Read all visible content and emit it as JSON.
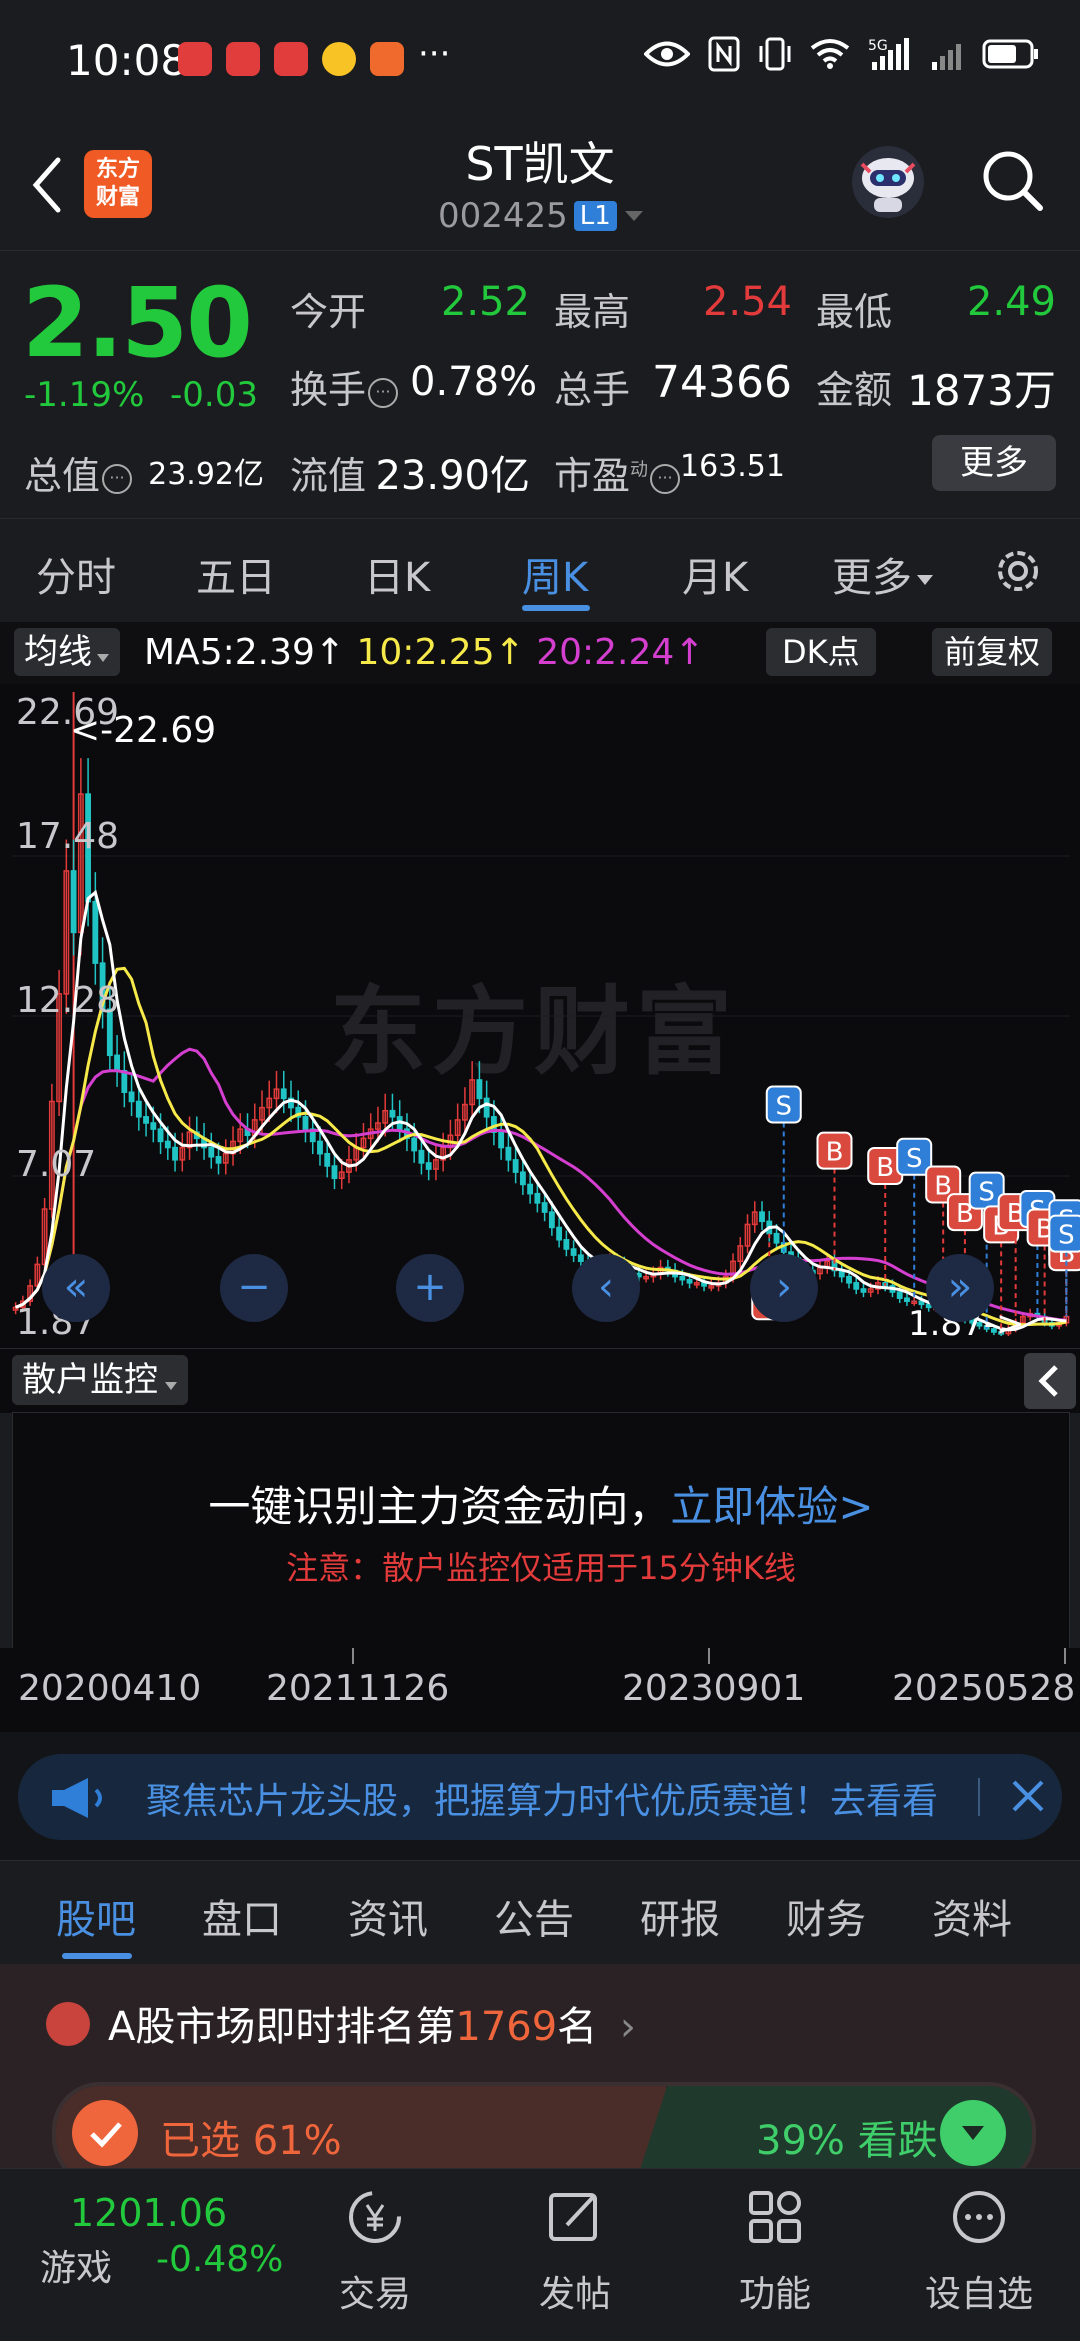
{
  "status": {
    "time": "10:08",
    "network": "5G",
    "more": "···"
  },
  "header": {
    "logo_line1": "东方",
    "logo_line2": "财富",
    "stock_name": "ST凯文",
    "stock_code": "002425",
    "level": "L1"
  },
  "quote": {
    "price": "2.50",
    "change_pct": "-1.19%",
    "change": "-0.03",
    "open_label": "今开",
    "open": "2.52",
    "high_label": "最高",
    "high": "2.54",
    "low_label": "最低",
    "low": "2.49",
    "turnover_label": "换手",
    "turnover": "0.78%",
    "volume_label": "总手",
    "volume": "74366",
    "amount_label": "金额",
    "amount": "1873万",
    "mktcap_label": "总值",
    "mktcap": "23.92亿",
    "float_label": "流值",
    "float": "23.90亿",
    "pe_label": "市盈",
    "pe_sup": "动",
    "pe": "163.51",
    "more_label": "更多"
  },
  "tabs": [
    "分时",
    "五日",
    "日K",
    "周K",
    "月K",
    "更多"
  ],
  "active_tab": "周K",
  "ma_row": {
    "selector": "均线",
    "ma5": "MA5:2.39↑",
    "ma10": "10:2.25↑",
    "ma20": "20:2.24↑",
    "dk": "DK点",
    "fq": "前复权"
  },
  "colors": {
    "up": "#e33b3b",
    "down": "#22c93c",
    "accent": "#4a90e2",
    "ma5": "#ffffff",
    "ma10": "#f6e94a",
    "ma20": "#d53fd0",
    "boll": "#20c4c4"
  },
  "chart": {
    "y_labels": [
      "22.69",
      "17.48",
      "12.28",
      "7.07",
      "1.87"
    ],
    "max_marker": "<-22.69",
    "min_marker": "1.87->",
    "watermark": "东方财富",
    "nav_prev": "«",
    "nav_minus": "−",
    "nav_plus": "+",
    "nav_left": "‹",
    "nav_right": "›",
    "nav_next": "»"
  },
  "chart_data": {
    "type": "candlestick",
    "period": "weekly",
    "ylim": [
      1.87,
      22.69
    ],
    "x_ticks": [
      "20200410",
      "20211126",
      "20230901",
      "20250528"
    ],
    "max": 22.69,
    "min": 1.87,
    "ma_labels": [
      "MA5:2.39↑",
      "10:2.25↑",
      "20:2.24↑"
    ],
    "closes_approx": [
      2.8,
      3.0,
      3.5,
      4.2,
      6.0,
      9.5,
      13.0,
      17.0,
      15.0,
      19.5,
      16.0,
      14.0,
      12.5,
      11.0,
      10.5,
      9.8,
      9.5,
      9.0,
      8.8,
      8.6,
      8.2,
      8.0,
      7.6,
      8.0,
      8.5,
      8.3,
      8.0,
      7.7,
      7.5,
      7.8,
      8.2,
      8.6,
      8.4,
      8.9,
      9.3,
      9.6,
      9.9,
      9.6,
      9.3,
      9.0,
      8.6,
      8.2,
      7.8,
      7.4,
      7.0,
      7.2,
      7.6,
      8.0,
      8.3,
      8.6,
      8.8,
      9.2,
      9.0,
      8.6,
      8.3,
      7.9,
      7.5,
      7.3,
      7.6,
      8.0,
      8.4,
      8.9,
      9.4,
      10.2,
      9.6,
      9.0,
      8.5,
      8.0,
      7.6,
      7.2,
      6.8,
      6.5,
      6.2,
      5.9,
      5.4,
      5.0,
      4.7,
      4.5,
      4.3,
      4.2,
      4.1,
      4.2,
      4.3,
      4.2,
      4.0,
      3.9,
      3.8,
      3.8,
      3.9,
      4.1,
      4.0,
      3.8,
      3.7,
      3.6,
      3.6,
      3.5,
      3.5,
      3.6,
      3.8,
      4.3,
      4.8,
      5.5,
      5.9,
      5.6,
      5.2,
      4.9,
      4.6,
      4.4,
      4.2,
      4.0,
      3.9,
      4.1,
      4.3,
      4.0,
      3.8,
      3.6,
      3.4,
      3.3,
      3.4,
      3.6,
      3.5,
      3.3,
      3.1,
      3.0,
      3.0,
      2.9,
      2.8,
      2.8,
      2.7,
      2.6,
      2.5,
      2.4,
      2.3,
      2.2,
      2.1,
      2.0,
      1.95,
      2.1,
      2.3,
      2.5,
      2.6,
      2.5,
      2.3,
      2.2,
      2.3,
      2.5
    ]
  },
  "signals": [
    {
      "t": "S",
      "i": 106,
      "v": 9.4
    },
    {
      "t": "B",
      "i": 113,
      "v": 7.9
    },
    {
      "t": "B",
      "i": 120,
      "v": 7.4
    },
    {
      "t": "S",
      "i": 124,
      "v": 7.7
    },
    {
      "t": "B",
      "i": 128,
      "v": 6.8
    },
    {
      "t": "B",
      "i": 131,
      "v": 5.9
    },
    {
      "t": "S",
      "i": 134,
      "v": 6.6
    },
    {
      "t": "B",
      "i": 136,
      "v": 5.5
    },
    {
      "t": "B",
      "i": 138,
      "v": 5.9
    },
    {
      "t": "S",
      "i": 141,
      "v": 6.0
    },
    {
      "t": "B",
      "i": 142,
      "v": 5.4
    },
    {
      "t": "S",
      "i": 149,
      "v": 5.7
    },
    {
      "t": "B",
      "i": 157,
      "v": 4.9
    },
    {
      "t": "B",
      "i": 160,
      "v": 4.9
    },
    {
      "t": "B",
      "i": 161,
      "v": 4.6
    },
    {
      "t": "B",
      "i": 173,
      "v": 4.6
    },
    {
      "t": "S",
      "i": 176,
      "v": 5.2
    },
    {
      "t": "B",
      "i": 104,
      "v": 3.0
    }
  ],
  "retail": {
    "selector": "散户监控",
    "main": "一键识别主力资金动向，",
    "link": "立即体验>",
    "note": "注意：散户监控仅适用于15分钟K线"
  },
  "banner": {
    "text": "聚焦芯片龙头股，把握算力时代优质赛道！去看看"
  },
  "content_tabs": [
    "股吧",
    "盘口",
    "资讯",
    "公告",
    "研报",
    "财务",
    "资料"
  ],
  "active_content_tab": "股吧",
  "rank": {
    "prefix": "A股市场即时排名第",
    "number": "1769",
    "suffix": "名",
    "arrow": "›"
  },
  "vote": {
    "bull": "已选 61%",
    "bear": "39% 看跌",
    "bull_pct": 61,
    "bear_pct": 39
  },
  "bottom_nav": {
    "index_value": "1201.06",
    "index_name": "游戏",
    "index_pct": "-0.48%",
    "items": [
      "交易",
      "发帖",
      "功能",
      "设自选"
    ]
  }
}
